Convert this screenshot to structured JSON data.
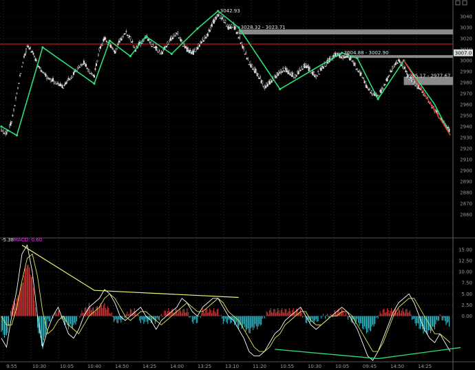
{
  "chart_data": [
    {
      "type": "candlestick",
      "title": "",
      "ylim": [
        2840,
        3050
      ],
      "y_ticks": [
        "3040",
        "3030",
        "3020",
        "3010",
        "3000",
        "2990",
        "2980",
        "2970",
        "2960",
        "2950",
        "2940",
        "2930",
        "2920",
        "2910",
        "2900",
        "2890",
        "2880",
        "2870",
        "2860"
      ],
      "x_ticks": [
        "9:55",
        "10:30",
        "10:05",
        "10:40",
        "14:50",
        "14:25",
        "14:00",
        "13:25",
        "13:10",
        "11:20",
        "10:55",
        "10:30",
        "10:05",
        "09:45",
        "14:50",
        "14:25"
      ],
      "current_price": "3007.0",
      "current_price_value": 3007.0,
      "resistance_line": 3015,
      "close_series": [
        2938,
        2933,
        2945,
        2970,
        2995,
        3013,
        3008,
        2996,
        2990,
        2984,
        2982,
        2978,
        2976,
        2982,
        2988,
        2994,
        2998,
        2990,
        2986,
        3010,
        3020,
        3014,
        3008,
        3018,
        3026,
        3020,
        3010,
        3016,
        3022,
        3015,
        3011,
        3006,
        3014,
        3020,
        3026,
        3016,
        3010,
        3006,
        3012,
        3018,
        3024,
        3034,
        3042,
        3038,
        3030,
        3032,
        3022,
        3010,
        2998,
        2992,
        2985,
        2976,
        2980,
        2985,
        2990,
        2992,
        2988,
        2986,
        2992,
        2996,
        2990,
        2986,
        2992,
        2998,
        3002,
        3006,
        3003,
        3005,
        3000,
        2992,
        2985,
        2975,
        2970,
        2968,
        2975,
        2985,
        2995,
        3000,
        2994,
        2985,
        2980,
        2975,
        2970,
        2962,
        2955,
        2948,
        2942,
        2935
      ],
      "zigzag": [
        [
          0,
          2940
        ],
        [
          3,
          2932
        ],
        [
          8,
          3012
        ],
        [
          18,
          2979
        ],
        [
          21,
          3018
        ],
        [
          25,
          3004
        ],
        [
          28,
          3022
        ],
        [
          33,
          3006
        ],
        [
          38,
          3029
        ],
        [
          42,
          3045
        ],
        [
          46,
          3030
        ],
        [
          54,
          2974
        ],
        [
          66,
          3007
        ],
        [
          69,
          3002
        ],
        [
          73,
          2965
        ],
        [
          78,
          3000
        ],
        [
          84,
          2960
        ],
        [
          87,
          2932
        ]
      ],
      "zigzag_markers": [
        [
          0,
          2940
        ],
        [
          3,
          2932
        ],
        [
          8,
          3012
        ],
        [
          18,
          2979
        ],
        [
          21,
          3018
        ],
        [
          25,
          3004
        ],
        [
          28,
          3022
        ],
        [
          33,
          3006
        ],
        [
          38,
          3029
        ],
        [
          42,
          3045
        ],
        [
          46,
          3030
        ],
        [
          54,
          2974
        ],
        [
          66,
          3007
        ],
        [
          69,
          3002
        ],
        [
          73,
          2965
        ],
        [
          78,
          3000
        ]
      ],
      "down_trend": [
        [
          78,
          3000
        ],
        [
          87,
          2932
        ]
      ],
      "annotations": [
        {
          "text": "3042.93",
          "x": 42,
          "y": 3045
        },
        {
          "text": "3028.32 - 3023.71",
          "x": 46,
          "y": 3030
        },
        {
          "text": "3004.88 - 3002.90",
          "x": 66,
          "y": 3007
        },
        {
          "text": "2985.17 - 2977.67",
          "x": 78,
          "y": 2986
        }
      ],
      "gap_zones": [
        {
          "from_x": 46,
          "to_x": 90,
          "y_high": 3028.3,
          "y_low": 3023.7
        },
        {
          "from_x": 66,
          "to_x": 90,
          "y_high": 3004.9,
          "y_low": 3002.9
        },
        {
          "from_x": 78,
          "to_x": 90,
          "y_high": 2985.2,
          "y_low": 2977.7
        }
      ]
    },
    {
      "type": "macd",
      "indicator_labels": {
        "dif": "-5.38",
        "macd": "MACD: 0.60"
      },
      "ylim": [
        -10,
        17
      ],
      "y_ticks": [
        "15.00",
        "12.50",
        "10.00",
        "7.50",
        "5.00",
        "2.50",
        "0.00"
      ],
      "dif": [
        -5,
        -7,
        0,
        6,
        14,
        16,
        10,
        0,
        -7,
        -3,
        0,
        2,
        -1,
        -4,
        -5,
        -3,
        0,
        2,
        3,
        4,
        6,
        5,
        3,
        0,
        -1,
        0,
        1,
        2,
        0,
        -1,
        -3,
        -1,
        0,
        1,
        2,
        4,
        3,
        1,
        0,
        2,
        3,
        4,
        4,
        2,
        0,
        -1,
        -3,
        -5,
        -8,
        -9,
        -9,
        -8,
        -6,
        -4,
        -3,
        -1,
        0,
        1,
        2,
        0,
        -2,
        -3,
        -2,
        -1,
        0,
        1,
        2,
        1,
        -1,
        -3,
        -6,
        -9,
        -10,
        -8,
        -5,
        -2,
        1,
        3,
        4,
        5,
        3,
        0,
        -3,
        -5,
        -6,
        -4,
        -6,
        -8
      ],
      "dea": [
        0,
        -2,
        -2,
        2,
        8,
        13,
        14,
        9,
        1,
        -4,
        -3,
        -1,
        0,
        -2,
        -3,
        -4,
        -2,
        0,
        1,
        2,
        4,
        5,
        4,
        2,
        0,
        -1,
        0,
        1,
        1,
        0,
        -1,
        -2,
        -1,
        0,
        1,
        2,
        3,
        2,
        1,
        1,
        2,
        3,
        4,
        3,
        1,
        0,
        -1,
        -3,
        -5,
        -7,
        -8,
        -8,
        -7,
        -5,
        -4,
        -2,
        -1,
        0,
        1,
        1,
        -1,
        -2,
        -2,
        -1,
        0,
        0,
        1,
        1,
        0,
        -2,
        -4,
        -6,
        -8,
        -8,
        -6,
        -3,
        0,
        2,
        3,
        4,
        4,
        2,
        0,
        -2,
        -4,
        -4,
        -5,
        -6
      ],
      "histogram": [
        -3,
        -4,
        2,
        3,
        6,
        10,
        7,
        -2,
        -6,
        -1,
        0,
        1,
        -1,
        -2,
        -2,
        0,
        1,
        2,
        1,
        2,
        2,
        1,
        -1,
        -1,
        0,
        1,
        1,
        -1,
        -1,
        -1,
        -1,
        0,
        1,
        1,
        1,
        1,
        1,
        -1,
        -1,
        1,
        1,
        1,
        1,
        -1,
        -1,
        -1,
        -2,
        -2,
        -3,
        -2,
        -2,
        0,
        1,
        1,
        1,
        1,
        1,
        1,
        1,
        -1,
        -1,
        -1,
        0,
        0,
        0,
        1,
        1,
        0,
        -1,
        -1,
        -2,
        -3,
        -2,
        0,
        1,
        1,
        1,
        1,
        1,
        1,
        -1,
        -2,
        -3,
        -3,
        -2,
        0,
        -1,
        -2
      ],
      "trend_high": [
        [
          4,
          16
        ],
        [
          18,
          5.8
        ],
        [
          46,
          4.2
        ]
      ],
      "trend_low": [
        [
          53,
          -7.5
        ],
        [
          73,
          -9.6
        ],
        [
          89,
          -7.1
        ]
      ]
    }
  ]
}
